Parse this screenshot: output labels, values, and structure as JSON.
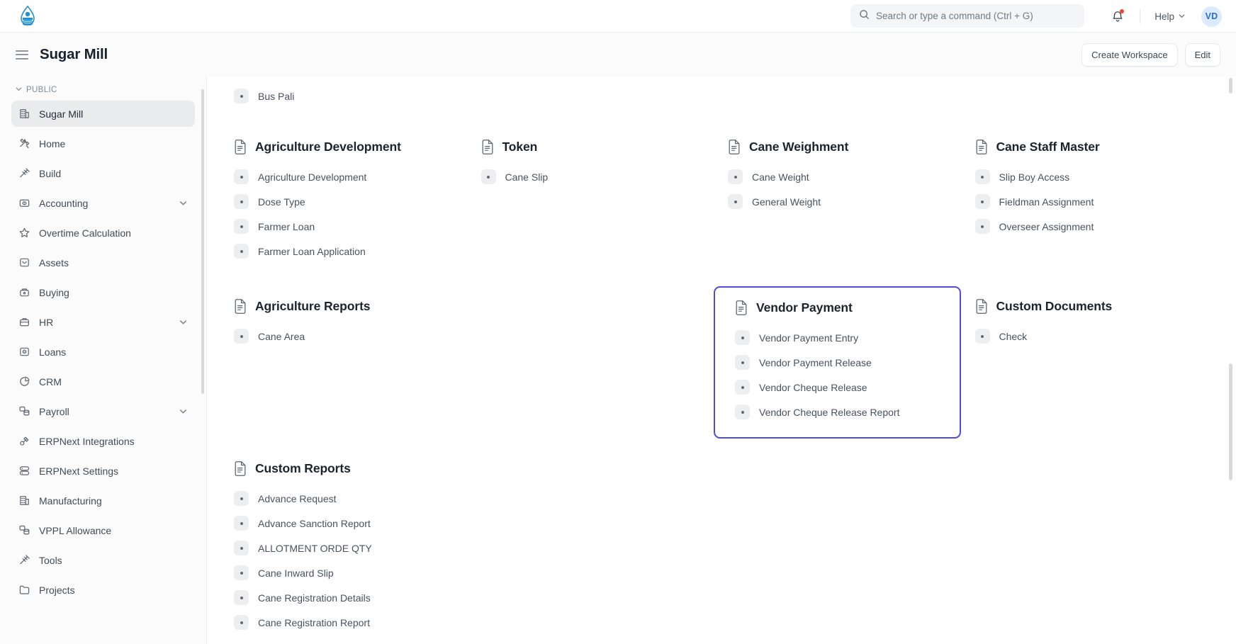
{
  "navbar": {
    "logo_icon": "sugar-mill-logo",
    "search": {
      "icon": "search-icon",
      "placeholder": "Search or type a command (Ctrl + G)",
      "value": ""
    },
    "notifications_icon": "bell-icon",
    "help_label": "Help",
    "help_chevron_icon": "chevron-down-icon",
    "avatar_initials": "VD"
  },
  "page_head": {
    "menu_icon": "hamburger-icon",
    "title": "Sugar Mill",
    "create_workspace_label": "Create Workspace",
    "edit_label": "Edit"
  },
  "sidebar": {
    "section_label": "PUBLIC",
    "section_chevron_icon": "chevron-down-icon",
    "items": [
      {
        "label": "Sugar Mill",
        "icon": "building-icon",
        "active": true,
        "expandable": false
      },
      {
        "label": "Home",
        "icon": "tools-icon",
        "active": false,
        "expandable": false
      },
      {
        "label": "Build",
        "icon": "hammer-icon",
        "active": false,
        "expandable": false
      },
      {
        "label": "Accounting",
        "icon": "cash-icon",
        "active": false,
        "expandable": true
      },
      {
        "label": "Overtime Calculation",
        "icon": "star-icon",
        "active": false,
        "expandable": false
      },
      {
        "label": "Assets",
        "icon": "box-icon",
        "active": false,
        "expandable": false
      },
      {
        "label": "Buying",
        "icon": "basket-icon",
        "active": false,
        "expandable": false
      },
      {
        "label": "HR",
        "icon": "briefcase-icon",
        "active": false,
        "expandable": true
      },
      {
        "label": "Loans",
        "icon": "wallet-icon",
        "active": false,
        "expandable": false
      },
      {
        "label": "CRM",
        "icon": "pie-chart-icon",
        "active": false,
        "expandable": false
      },
      {
        "label": "Payroll",
        "icon": "database-icon",
        "active": false,
        "expandable": true
      },
      {
        "label": "ERPNext Integrations",
        "icon": "plug-icon",
        "active": false,
        "expandable": false
      },
      {
        "label": "ERPNext Settings",
        "icon": "server-icon",
        "active": false,
        "expandable": false
      },
      {
        "label": "Manufacturing",
        "icon": "factory-icon",
        "active": false,
        "expandable": false
      },
      {
        "label": "VPPL Allowance",
        "icon": "database-icon",
        "active": false,
        "expandable": false
      },
      {
        "label": "Tools",
        "icon": "hammer-icon",
        "active": false,
        "expandable": false
      },
      {
        "label": "Projects",
        "icon": "folder-icon",
        "active": false,
        "expandable": false
      }
    ]
  },
  "main": {
    "partial_top_item": {
      "label": "Bus Pali"
    },
    "row1": [
      {
        "title": "Agriculture Development",
        "icon": "document-icon",
        "highlight": false,
        "links": [
          "Agriculture Development",
          "Dose Type",
          "Farmer Loan",
          "Farmer Loan Application"
        ]
      },
      {
        "title": "Token",
        "icon": "document-icon",
        "highlight": false,
        "links": [
          "Cane Slip"
        ]
      },
      {
        "title": "Cane Weighment",
        "icon": "document-icon",
        "highlight": false,
        "links": [
          "Cane Weight",
          "General Weight"
        ]
      },
      {
        "title": "Cane Staff Master",
        "icon": "document-icon",
        "highlight": false,
        "links": [
          "Slip Boy Access",
          "Fieldman Assignment",
          "Overseer Assignment"
        ]
      }
    ],
    "row2": [
      {
        "title": "Agriculture Reports",
        "icon": "document-icon",
        "highlight": false,
        "links": [
          "Cane Area"
        ]
      },
      {
        "title": "",
        "icon": "",
        "highlight": false,
        "links": []
      },
      {
        "title": "Vendor Payment",
        "icon": "document-icon",
        "highlight": true,
        "links": [
          "Vendor Payment Entry",
          "Vendor Payment Release",
          "Vendor Cheque Release",
          "Vendor Cheque Release Report"
        ]
      },
      {
        "title": "Custom Documents",
        "icon": "document-icon",
        "highlight": false,
        "links": [
          "Check"
        ]
      }
    ],
    "row3": [
      {
        "title": "Custom Reports",
        "icon": "document-icon",
        "highlight": false,
        "links": [
          "Advance Request",
          "Advance Sanction Report",
          "ALLOTMENT ORDE QTY",
          "Cane Inward Slip",
          "Cane Registration Details",
          "Cane Registration Report"
        ]
      }
    ]
  },
  "colors": {
    "highlight_border": "#4b4ddb",
    "accent": "#2b6cd4",
    "notification_dot": "#f04438"
  }
}
